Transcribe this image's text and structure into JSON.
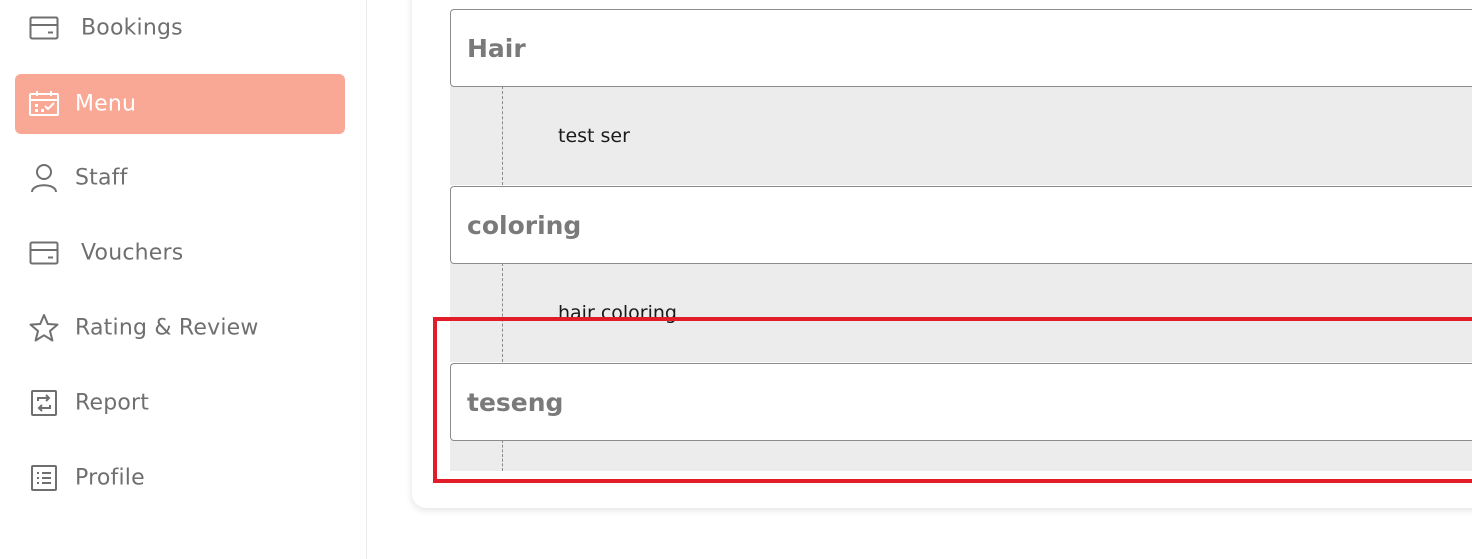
{
  "sidebar": {
    "items": [
      {
        "label": "Bookings",
        "icon": "card-icon",
        "active": false
      },
      {
        "label": "Menu",
        "icon": "calendar-check-icon",
        "active": true
      },
      {
        "label": "Staff",
        "icon": "user-icon",
        "active": false
      },
      {
        "label": "Vouchers",
        "icon": "card-icon",
        "active": false
      },
      {
        "label": "Rating & Review",
        "icon": "star-icon",
        "active": false
      },
      {
        "label": "Report",
        "icon": "refresh-square-icon",
        "active": false
      },
      {
        "label": "Profile",
        "icon": "list-icon",
        "active": false
      }
    ],
    "active_color": "#f9a896"
  },
  "menu": {
    "categories": [
      {
        "name": "Hair",
        "services": [
          "test ser"
        ]
      },
      {
        "name": "coloring",
        "services": [
          "hair coloring"
        ]
      },
      {
        "name": "teseng",
        "services": []
      }
    ]
  },
  "highlight_color": "#e11d2a"
}
